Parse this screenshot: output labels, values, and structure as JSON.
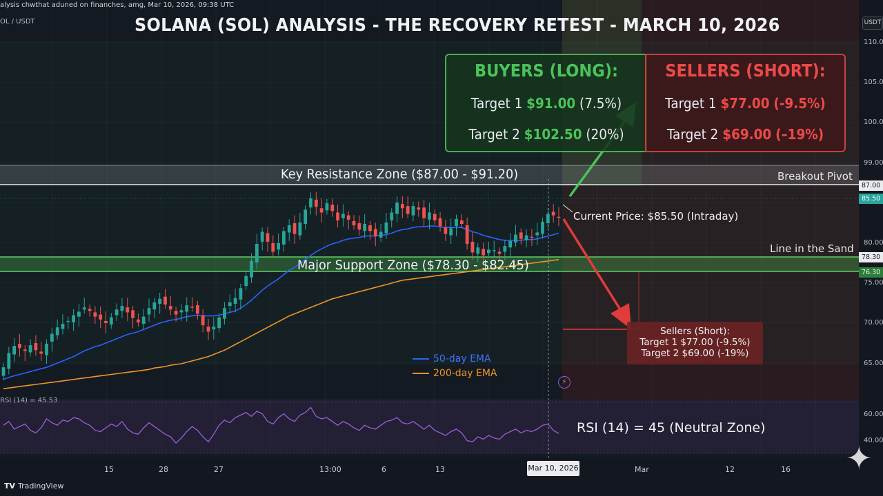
{
  "header": {
    "meta_text": "alysis chwthat aduned on finanches, amg, Mar 10, 2026, 09:38 UTC",
    "pair": "OL / USDT",
    "title": "SOLANA (SOL) ANALYSIS - THE RECOVERY RETEST - MARCH 10, 2026",
    "currency_button": "USDT"
  },
  "panels": {
    "buyers": {
      "heading": "BUYERS (LONG):",
      "t1_label": "Target 1",
      "t1_price": "$91.00",
      "t1_pct": "(7.5%)",
      "t2_label": "Target 2",
      "t2_price": "$102.50",
      "t2_pct": "(20%)"
    },
    "sellers": {
      "heading": "SELLERS (SHORT):",
      "t1_label": "Target 1",
      "t1_price": "$77.00",
      "t1_pct": "(-9.5%)",
      "t2_label": "Target 2",
      "t2_price": "$69.00",
      "t2_pct": "(–19%)"
    }
  },
  "annotations": {
    "resistance_zone": "Key Resistance Zone ($87.00 - $91.20)",
    "support_zone": "Major Support Zone ($78.30 - $82.45)",
    "breakout_pivot": "Breakout Pivot",
    "line_in_sand": "Line in the Sand",
    "current_price": "Current Price: $85.50 (Intraday)",
    "sellers_box_title": "Sellers (Short):",
    "sellers_box_t1": "Target 1 $77.00 (-9.5%)",
    "sellers_box_t2": "Target 2 $69.00 (-19%)",
    "rsi_label": "RSI (14) = 45.53",
    "rsi_summary": "RSI (14) = 45 (Neutral Zone)"
  },
  "legend": {
    "ema50": "50-day EMA",
    "ema200": "200-day EMA"
  },
  "price_axis": {
    "ticks": [
      "110.00",
      "105.00",
      "100.00",
      "99.00",
      "80.00",
      "75.00",
      "70.00",
      "65.00"
    ],
    "rsi_ticks": [
      "60.00",
      "40.00"
    ],
    "tag_87": "87.00",
    "tag_current": "85.50",
    "tag_7830": "78.30",
    "tag_7630": "76.30"
  },
  "time_axis": {
    "labels": [
      "15",
      "28",
      "27",
      "13:00",
      "6",
      "13",
      "Mar",
      "12",
      "16"
    ],
    "current_date": "Mar 10, 2026"
  },
  "footer": {
    "brand": "TradingView"
  },
  "colors": {
    "bull": "#26a69a",
    "bear": "#ef5350",
    "ema50": "#2962ff",
    "ema200": "#f0932b",
    "rsi": "#9c5fd6",
    "buy_accent": "#4bc35a",
    "sell_accent": "#ec4a49"
  },
  "chart_data": {
    "type": "candlestick",
    "title": "SOLANA (SOL) ANALYSIS - THE RECOVERY RETEST - MARCH 10, 2026",
    "ylim": [
      60,
      112
    ],
    "resistance_zone": [
      87.0,
      91.2
    ],
    "support_zone": [
      78.3,
      82.45
    ],
    "current_price": 85.5,
    "targets": {
      "long": [
        91.0,
        102.5
      ],
      "short": [
        77.0,
        69.0
      ]
    },
    "close": [
      64.5,
      66.5,
      67.5,
      67.2,
      66.8,
      67.6,
      66.9,
      66.4,
      67.8,
      69.2,
      70.1,
      70.6,
      71.0,
      71.8,
      72.3,
      72.9,
      72.4,
      71.6,
      71.2,
      70.7,
      71.5,
      72.6,
      73.1,
      72.2,
      71.4,
      70.8,
      71.6,
      72.8,
      73.6,
      74.1,
      73.3,
      72.6,
      71.9,
      72.5,
      73.2,
      72.9,
      72.0,
      70.4,
      69.5,
      70.2,
      71.5,
      72.8,
      73.6,
      74.2,
      75.6,
      77.3,
      79.4,
      81.8,
      83.5,
      82.1,
      80.7,
      81.9,
      83.6,
      84.4,
      83.2,
      84.8,
      86.6,
      88.2,
      87.0,
      86.2,
      87.5,
      86.4,
      85.1,
      86.0,
      85.2,
      84.4,
      83.8,
      84.6,
      83.6,
      82.9,
      83.5,
      84.8,
      86.2,
      87.6,
      86.8,
      86.0,
      87.1,
      86.6,
      85.4,
      86.2,
      85.1,
      84.3,
      83.2,
      84.0,
      85.3,
      84.6,
      81.8,
      80.6,
      81.3,
      80.2,
      81.0,
      80.9,
      80.4,
      81.5,
      82.2,
      83.1,
      82.5,
      83.0,
      82.7,
      83.4,
      84.9,
      86.0,
      85.8,
      85.5
    ],
    "ema50": [
      62.8,
      63.1,
      63.3,
      63.5,
      63.7,
      63.9,
      64.1,
      64.3,
      64.5,
      64.8,
      65.1,
      65.4,
      65.7,
      66.0,
      66.4,
      66.8,
      67.1,
      67.4,
      67.6,
      67.9,
      68.2,
      68.5,
      68.8,
      69.1,
      69.3,
      69.5,
      69.8,
      70.1,
      70.4,
      70.7,
      70.9,
      71.1,
      71.2,
      71.4,
      71.6,
      71.7,
      71.8,
      71.7,
      71.7,
      71.7,
      71.8,
      72.0,
      72.2,
      72.4,
      72.8,
      73.3,
      73.9,
      74.6,
      75.3,
      75.9,
      76.4,
      76.9,
      77.5,
      78.1,
      78.5,
      79.0,
      79.6,
      80.2,
      80.7,
      81.1,
      81.5,
      81.8,
      82.0,
      82.3,
      82.5,
      82.6,
      82.7,
      82.9,
      82.9,
      82.9,
      83.0,
      83.1,
      83.3,
      83.6,
      83.8,
      83.9,
      84.1,
      84.2,
      84.2,
      84.3,
      84.3,
      84.2,
      84.1,
      84.1,
      84.1,
      84.1,
      83.8,
      83.5,
      83.3,
      83.0,
      82.8,
      82.6,
      82.4,
      82.3,
      82.3,
      82.3,
      82.3,
      82.4,
      82.4,
      82.5,
      82.7,
      82.9,
      83.1,
      83.3
    ],
    "ema200": [
      61.5,
      61.6,
      61.7,
      61.8,
      61.9,
      62.0,
      62.1,
      62.2,
      62.3,
      62.4,
      62.5,
      62.6,
      62.7,
      62.8,
      62.9,
      63.0,
      63.1,
      63.2,
      63.3,
      63.4,
      63.5,
      63.6,
      63.7,
      63.8,
      63.9,
      64.0,
      64.1,
      64.2,
      64.4,
      64.5,
      64.6,
      64.8,
      64.9,
      65.0,
      65.2,
      65.4,
      65.6,
      65.8,
      66.0,
      66.3,
      66.6,
      66.9,
      67.3,
      67.7,
      68.1,
      68.5,
      68.9,
      69.3,
      69.7,
      70.1,
      70.5,
      70.9,
      71.3,
      71.7,
      72.0,
      72.3,
      72.6,
      72.9,
      73.2,
      73.5,
      73.8,
      74.1,
      74.3,
      74.5,
      74.7,
      74.9,
      75.1,
      75.3,
      75.5,
      75.7,
      75.9,
      76.1,
      76.3,
      76.5,
      76.7,
      76.8,
      76.9,
      77.0,
      77.1,
      77.2,
      77.3,
      77.4,
      77.5,
      77.6,
      77.7,
      77.8,
      77.9,
      78.0,
      78.1,
      78.2,
      78.3,
      78.4,
      78.5,
      78.6,
      78.7,
      78.8,
      78.9,
      79.0,
      79.1,
      79.2,
      79.3,
      79.4,
      79.5,
      79.6
    ],
    "rsi": [
      52,
      55,
      49,
      51,
      53,
      48,
      46,
      50,
      57,
      54,
      52,
      56,
      55,
      58,
      57,
      54,
      52,
      48,
      47,
      50,
      53,
      51,
      55,
      49,
      46,
      45,
      50,
      54,
      51,
      48,
      45,
      43,
      38,
      42,
      47,
      51,
      48,
      43,
      39,
      45,
      52,
      56,
      54,
      58,
      60,
      62,
      59,
      63,
      61,
      55,
      53,
      58,
      61,
      57,
      55,
      60,
      62,
      66,
      59,
      57,
      58,
      55,
      52,
      55,
      53,
      50,
      48,
      52,
      50,
      49,
      52,
      55,
      56,
      58,
      54,
      53,
      55,
      52,
      49,
      52,
      48,
      46,
      44,
      47,
      49,
      46,
      40,
      39,
      43,
      41,
      44,
      42,
      41,
      45,
      47,
      49,
      46,
      48,
      47,
      49,
      52,
      53,
      48,
      45.5
    ],
    "rsi_ylim": [
      30,
      70
    ]
  }
}
